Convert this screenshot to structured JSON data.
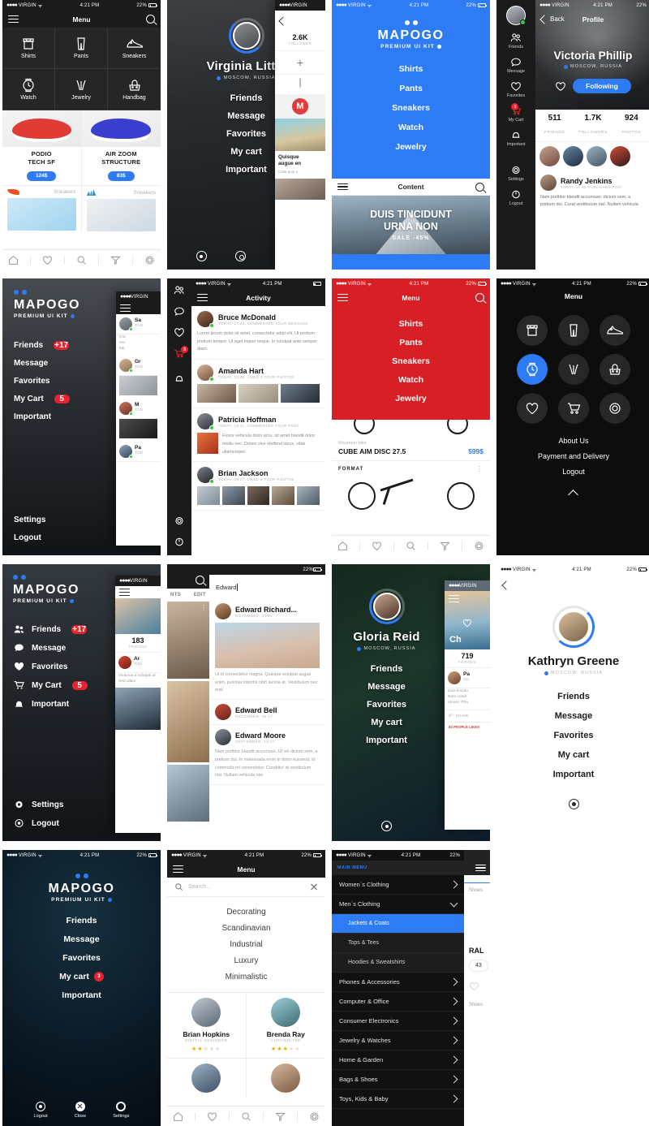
{
  "status_bar": {
    "carrier": "VIRGIN",
    "time": "4:21 PM",
    "battery": "22%"
  },
  "brand": {
    "name": "MAPOGO",
    "tagline": "PREMIUM UI KIT",
    "accent": "#2e7bf6",
    "red": "#d81f26"
  },
  "screens": {
    "menu_categories": {
      "title": "Menu",
      "categories": [
        {
          "label": "Shirts",
          "icon": "shirt-icon"
        },
        {
          "label": "Pants",
          "icon": "pants-icon"
        },
        {
          "label": "Sneakers",
          "icon": "sneaker-icon"
        },
        {
          "label": "Watch",
          "icon": "watch-icon"
        },
        {
          "label": "Jewelry",
          "icon": "jewelry-icon"
        },
        {
          "label": "Handbag",
          "icon": "handbag-icon"
        }
      ],
      "products": [
        {
          "name_line1": "PODIO",
          "name_line2": "TECH SF",
          "price": "124$"
        },
        {
          "name_line1": "AIR ZOOM",
          "name_line2": "STRUCTURE",
          "price": "83$"
        }
      ],
      "brand_rows": [
        {
          "brand": "nike",
          "label": "Sneakers"
        },
        {
          "brand": "adidas",
          "label": "Sneakers"
        }
      ],
      "tabs": [
        "home-icon",
        "heart-icon",
        "search-icon",
        "filter-icon",
        "gear-icon"
      ]
    },
    "profile_virginia": {
      "name": "Virginia Little",
      "location": "MOSCOW, RUSSIA",
      "menu": [
        "Friends",
        "Message",
        "Favorites",
        "My cart",
        "Important"
      ],
      "bottom_icons": [
        "logout-icon",
        "settings-icon"
      ],
      "peek": {
        "count": "2.6K",
        "count_label": "FOLLOWER",
        "post_title_l1": "Quisque",
        "post_title_l2": "augue en",
        "post_sub": "Cras quis n"
      }
    },
    "menu_blue": {
      "items": [
        "Shirts",
        "Pants",
        "Sneakers",
        "Watch",
        "Jewelry"
      ],
      "content_title": "Content",
      "hero_l1": "DUIS TINCIDUNT",
      "hero_l2": "URNA NON",
      "hero_sale": "SALE -45%"
    },
    "profile_victoria": {
      "back": "Back",
      "title": "Profile",
      "name": "Victoria Phillip",
      "location": "MOSCOW, RUSSIA",
      "follow_button": "Following",
      "rail": [
        {
          "label": "Friends",
          "icon": "friends-icon"
        },
        {
          "label": "Message",
          "icon": "message-icon"
        },
        {
          "label": "Favorites",
          "icon": "heart-icon"
        },
        {
          "label": "My Cart",
          "icon": "cart-icon",
          "badge": "3"
        },
        {
          "label": "Important",
          "icon": "bell-icon"
        },
        {
          "label": "Settings",
          "icon": "gear-icon"
        },
        {
          "label": "Logout",
          "icon": "power-icon"
        }
      ],
      "stats": [
        {
          "value": "511",
          "label": "FRIENDS"
        },
        {
          "value": "1.7K",
          "label": "FOLLOWERS"
        },
        {
          "value": "924",
          "label": "PHOTOS"
        }
      ],
      "post": {
        "author": "Randy Jenkins",
        "meta": "TODAY, 14:35. PUBLISHED POST",
        "text": "Nam porttitor blandit accumsan. dictum sem, a pretium dui. Curat vestibulum nisl. Nullam vehicula"
      }
    },
    "sidebar_mapogo_1": {
      "items": [
        {
          "label": "Friends",
          "badge": "+17"
        },
        {
          "label": "Message",
          "badge": ""
        },
        {
          "label": "Favorites",
          "badge": ""
        },
        {
          "label": "My Cart",
          "badge": "5"
        },
        {
          "label": "Important",
          "badge": ""
        }
      ],
      "bottom": [
        "Settings",
        "Logout"
      ],
      "peek_names": [
        "Sa",
        "Gr",
        "M",
        "Pa"
      ]
    },
    "activity": {
      "title": "Activity",
      "items": [
        {
          "name": "Bruce McDonald",
          "meta": "TODAY, 17:24. COMMENTED YOUR MESSAGE",
          "text": "Lorem ipsum dolor sit amet, consectetur adipi elit. Ut pretium pretium tempor. Ut eget impse neque. In volutpat ante semper diam.",
          "thumbs": 0
        },
        {
          "name": "Amanda Hart",
          "meta": "TODAY, 13:06. LIKED 3 YOUR PHOTOS",
          "text": "",
          "thumbs": 3
        },
        {
          "name": "Patricia Hoffman",
          "meta": "TODAY, 18:41. COMMENTED YOUR POST",
          "text": "Fusce vehicula dolor arcu, sit amet blandit dolor mollis nec. Donec vive eleifend lacus, vitae ullamcorper.",
          "thumbs": 1
        },
        {
          "name": "Brian Jackson",
          "meta": "TODAY, 09:27. LIKED 5 YOUR PHOTOS",
          "text": "",
          "thumbs": 5
        }
      ],
      "rail": [
        "friends-icon",
        "message-icon",
        "heart-icon",
        "cart-icon",
        "bell-icon",
        "gear-icon",
        "power-icon"
      ],
      "cart_badge": "3"
    },
    "menu_red": {
      "title": "Menu",
      "items": [
        "Shirts",
        "Pants",
        "Sneakers",
        "Watch",
        "Jewelry"
      ],
      "product": {
        "category": "Mountain bike",
        "name": "CUBE AIM DISC 27.5",
        "price": "599$"
      },
      "second_brand": "FORMAT"
    },
    "menu_dark_circles": {
      "title": "Menu",
      "icons": [
        {
          "icon": "shirt-icon",
          "active": false
        },
        {
          "icon": "pants-icon",
          "active": false
        },
        {
          "icon": "sneaker-icon",
          "active": false
        },
        {
          "icon": "watch-icon",
          "active": true
        },
        {
          "icon": "jewelry-icon",
          "active": false
        },
        {
          "icon": "handbag-icon",
          "active": false
        },
        {
          "icon": "heart-icon",
          "active": false
        },
        {
          "icon": "cart-icon",
          "active": false
        },
        {
          "icon": "gear-icon",
          "active": false
        }
      ],
      "links": [
        "About Us",
        "Payment and Delivery",
        "Logout"
      ]
    },
    "sidebar_mapogo_2": {
      "items": [
        {
          "label": "Friends",
          "icon": "friends-icon",
          "badge": "+17"
        },
        {
          "label": "Message",
          "icon": "message-icon",
          "badge": ""
        },
        {
          "label": "Favorites",
          "icon": "heart-icon",
          "badge": ""
        },
        {
          "label": "My Cart",
          "icon": "cart-icon",
          "badge": "5"
        },
        {
          "label": "Important",
          "icon": "bell-icon",
          "badge": ""
        }
      ],
      "bottom": [
        {
          "label": "Settings",
          "icon": "gear-icon"
        },
        {
          "label": "Logout",
          "icon": "power-icon"
        }
      ],
      "peek": {
        "count": "183",
        "count_label": "FRIENDS",
        "name": "Ar",
        "text": "Vivamus a volutpat al Sed ullam"
      }
    },
    "search_results": {
      "query": "Edward",
      "tabs": [
        "NTS",
        "EDIT"
      ],
      "results": [
        {
          "name": "Edward Richard...",
          "date": "NOVEMBER, 23:01",
          "has_image": true,
          "text": "Ut id consectetur magna. Quisque volutpat augue enim, pulvinar lobortis nibh lacinia at. Vestibulum nec erat."
        },
        {
          "name": "Edward Bell",
          "date": "DECEMBER, 05:17",
          "has_image": false,
          "text": ""
        },
        {
          "name": "Edward Moore",
          "date": "SEPTEMBER, 16:47",
          "has_image": false,
          "text": "Nam porttitor blandit accumsan. Ut vel dictum sem, a pretium dui. In malesuada enim in dolor euismod, id commodo mi consectetur. Curabitur at vestibulum nisi. Nullam vehicula nisi"
        }
      ]
    },
    "profile_gloria": {
      "name": "Gloria Reid",
      "location": "MOSCOW, RUSSIA",
      "menu": [
        "Friends",
        "Message",
        "Favorites",
        "My cart",
        "Important"
      ],
      "peek": {
        "hero_word": "Ch",
        "count": "719",
        "count_label": "FRIENDS",
        "name": "Pa",
        "text_l1": "Duis tincidu",
        "text_l2": "Nam condi",
        "text_l3": "ornare. Phu",
        "share": "SHARE",
        "likes": "80 PEOPLE LIKES"
      }
    },
    "profile_kathryn": {
      "name": "Kathryn Greene",
      "location": "MOSCOW, RUSSIA",
      "menu": [
        "Friends",
        "Message",
        "Favorites",
        "My cart",
        "Important"
      ]
    },
    "menu_night": {
      "items": [
        {
          "label": "Friends",
          "badge": ""
        },
        {
          "label": "Message",
          "badge": ""
        },
        {
          "label": "Favorites",
          "badge": ""
        },
        {
          "label": "My cart",
          "badge": "3"
        },
        {
          "label": "Important",
          "badge": ""
        }
      ],
      "actions": [
        {
          "label": "Logout",
          "icon": "power-icon"
        },
        {
          "label": "Close",
          "icon": "close-icon"
        },
        {
          "label": "Settings",
          "icon": "gear-icon"
        }
      ]
    },
    "menu_search_people": {
      "title": "Menu",
      "search_placeholder": "Search...",
      "links": [
        "Decorating",
        "Scandinavian",
        "Industrial",
        "Luxury",
        "Minimalistic"
      ],
      "people": [
        {
          "name": "Brian Hopkins",
          "role": "DIGITAL DESIGNER",
          "rating": 2
        },
        {
          "name": "Brenda Ray",
          "role": "COPYWRITER",
          "rating": 3
        }
      ],
      "tabs": [
        "home-icon",
        "heart-icon",
        "search-icon",
        "filter-icon",
        "gear-icon"
      ]
    },
    "accordion_nav": {
      "header": "MAIN MENU",
      "items": [
        {
          "label": "Women`s Clothing",
          "state": "collapsed",
          "level": 0
        },
        {
          "label": "Men`s Clothing",
          "state": "expanded",
          "level": 0
        },
        {
          "label": "Jackets & Coats",
          "state": "selected",
          "level": 1
        },
        {
          "label": "Tops & Tees",
          "state": "child",
          "level": 1
        },
        {
          "label": "Hoodies & Sweatshirts",
          "state": "child",
          "level": 1
        },
        {
          "label": "Phones & Accessories",
          "state": "collapsed",
          "level": 0
        },
        {
          "label": "Computer & Office",
          "state": "collapsed",
          "level": 0
        },
        {
          "label": "Consumer Electronics",
          "state": "collapsed",
          "level": 0
        },
        {
          "label": "Jewelry & Watches",
          "state": "collapsed",
          "level": 0
        },
        {
          "label": "Home & Garden",
          "state": "collapsed",
          "level": 0
        },
        {
          "label": "Bags & Shoes",
          "state": "collapsed",
          "level": 0
        },
        {
          "label": "Toys, Kids & Baby",
          "state": "collapsed",
          "level": 0
        }
      ],
      "peek": {
        "word1": "Shoes",
        "word2": "RAL",
        "number": "43",
        "word3": "Shoes"
      }
    }
  }
}
